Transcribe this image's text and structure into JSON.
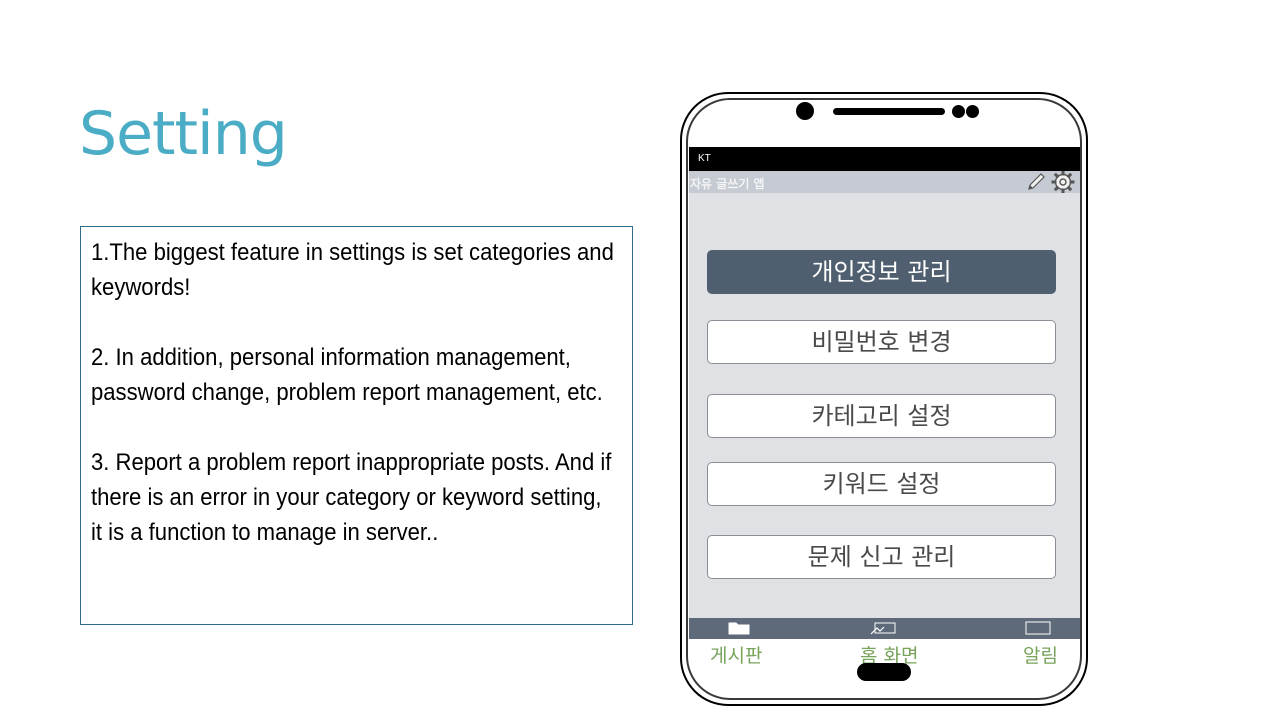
{
  "slide": {
    "title": "Setting",
    "points": [
      "1.The biggest feature in settings is set categories and keywords!",
      "2. In addition, personal information management, password change, problem report management, etc.",
      "3. Report a problem report inappropriate posts. And if there is an error in your category or keyword setting, it is a function to manage in server.."
    ]
  },
  "phone": {
    "status": {
      "carrier": "KT"
    },
    "appbar": {
      "title": "자유 글쓰기 앱",
      "icons": [
        "pencil-icon",
        "gear-icon"
      ]
    },
    "menu": [
      {
        "label": "개인정보 관리",
        "active": true
      },
      {
        "label": "비밀번호 변경",
        "active": false
      },
      {
        "label": "카테고리 설정",
        "active": false
      },
      {
        "label": "키워드 설정",
        "active": false
      },
      {
        "label": "문제 신고 관리",
        "active": false
      }
    ],
    "tabs": [
      {
        "label": "게시판",
        "icon": "folder-icon"
      },
      {
        "label": "홈 화면",
        "icon": "home-icon"
      },
      {
        "label": "알림",
        "icon": "notification-icon"
      }
    ]
  },
  "colors": {
    "title": "#4bacc6",
    "active_button": "#4f5f70",
    "tab_label": "#77a35a",
    "tabbar": "#5e6a7a",
    "screen_bg": "#dfe1e5"
  }
}
